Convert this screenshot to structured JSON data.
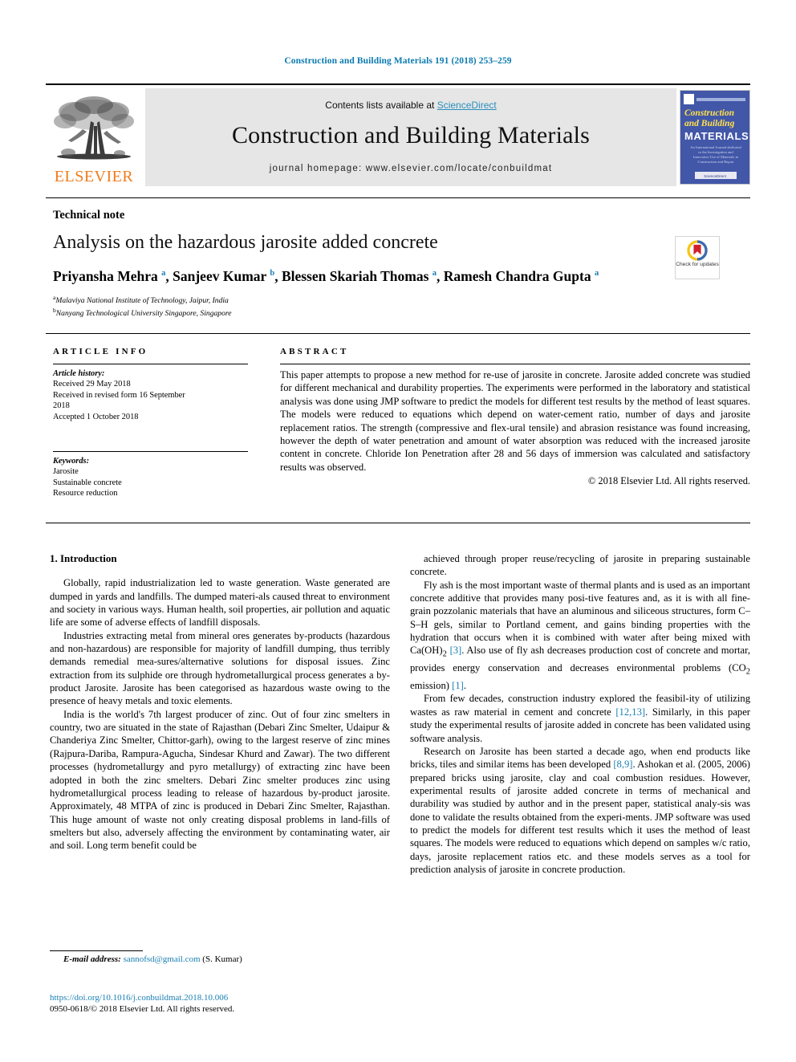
{
  "running_head": "Construction and Building Materials 191 (2018) 253–259",
  "masthead": {
    "contents_prefix": "Contents lists available at ",
    "sciencedirect": "ScienceDirect",
    "journal_title": "Construction and Building Materials",
    "homepage": "journal homepage: www.elsevier.com/locate/conbuildmat",
    "publisher_name": "ELSEVIER",
    "publisher_color": "#F07C1C",
    "band_color": "#e6e6e6",
    "cover": {
      "line1": "Construction",
      "line2": "and Building",
      "line3": "MATERIALS",
      "subtitle": "An International Journal dedicated to the Investigation and Innovative Use of Materials in Construction and Repair",
      "footer": "ScienceDirect",
      "bg_color": "#4257a8",
      "title_color": "#ffe14d"
    }
  },
  "article": {
    "doctype": "Technical note",
    "title": "Analysis on the hazardous jarosite added concrete",
    "authors_html": "Priyansha Mehra <sup>a</sup>, Sanjeev Kumar <sup>b</sup>, Blessen Skariah Thomas <sup>a</sup>, Ramesh Chandra Gupta <sup>a</sup>",
    "affiliations": [
      {
        "marker": "a",
        "text": "Malaviya National Institute of Technology, Jaipur, India"
      },
      {
        "marker": "b",
        "text": "Nanyang Technological University Singapore, Singapore"
      }
    ],
    "crossmark_label": "Check for updates"
  },
  "article_info": {
    "heading": "ARTICLE INFO",
    "history_heading": "Article history:",
    "history": [
      "Received 29 May 2018",
      "Received in revised form 16 September",
      "2018",
      "Accepted 1 October 2018"
    ],
    "keywords_heading": "Keywords:",
    "keywords": [
      "Jarosite",
      "Sustainable concrete",
      "Resource reduction"
    ]
  },
  "abstract": {
    "heading": "ABSTRACT",
    "text": "This paper attempts to propose a new method for re-use of jarosite in concrete. Jarosite added concrete was studied for different mechanical and durability properties. The experiments were performed in the laboratory and statistical analysis was done using JMP software to predict the models for different test results by the method of least squares. The models were reduced to equations which depend on water-cement ratio, number of days and jarosite replacement ratios. The strength (compressive and flex-ural tensile) and abrasion resistance was found increasing, however the depth of water penetration and amount of water absorption was reduced with the increased jarosite content in concrete. Chloride Ion Penetration after 28 and 56 days of immersion was calculated and satisfactory results was observed.",
    "copyright": "© 2018 Elsevier Ltd. All rights reserved."
  },
  "body": {
    "section_heading": "1. Introduction",
    "left_paragraphs": [
      "Globally, rapid industrialization led to waste generation. Waste generated are dumped in yards and landfills. The dumped materi-als caused threat to environment and society in various ways. Human health, soil properties, air pollution and aquatic life are some of adverse effects of landfill disposals.",
      "Industries extracting metal from mineral ores generates by-products (hazardous and non-hazardous) are responsible for majority of landfill dumping, thus terribly demands remedial mea-sures/alternative solutions for disposal issues. Zinc extraction from its sulphide ore through hydrometallurgical process generates a by-product Jarosite. Jarosite has been categorised as hazardous waste owing to the presence of heavy metals and toxic elements.",
      "India is the world's 7th largest producer of zinc. Out of four zinc smelters in country, two are situated in the state of Rajasthan (Debari Zinc Smelter, Udaipur & Chanderiya Zinc Smelter, Chittor-garh), owing to the largest reserve of zinc mines (Rajpura-Dariba, Rampura-Agucha, Sindesar Khurd and Zawar). The two different processes (hydrometallurgy and pyro metallurgy) of extracting zinc have been adopted in both the zinc smelters. Debari Zinc smelter produces zinc using hydrometallurgical process leading to release of hazardous by-product jarosite. Approximately, 48 MTPA of zinc is produced in Debari Zinc Smelter, Rajasthan. This huge amount of waste not only creating disposal problems in land-fills of smelters but also, adversely affecting the environment by contaminating water, air and soil. Long term benefit could be"
    ],
    "right_paragraphs_html": [
      "achieved through proper reuse/recycling of jarosite in preparing sustainable concrete.",
      "Fly ash is the most important waste of thermal plants and is used as an important concrete additive that provides many posi-tive features and, as it is with all fine-grain pozzolanic materials that have an aluminous and siliceous structures, form C–S–H gels, similar to Portland cement, and gains binding properties with the hydration that occurs when it is combined with water after being mixed with Ca(OH)<sub>2</sub> <span class=\"ref\">[3]</span>. Also use of fly ash decreases production cost of concrete and mortar, provides energy conservation and decreases environmental problems (CO<sub>2</sub> emission) <span class=\"ref\">[1]</span>.",
      "From few decades, construction industry explored the feasibil-ity of utilizing wastes as raw material in cement and concrete <span class=\"ref\">[12,13]</span>. Similarly, in this paper study the experimental results of jarosite added in concrete has been validated using software analysis.",
      "Research on Jarosite has been started a decade ago, when end products like bricks, tiles and similar items has been developed <span class=\"ref\">[8,9]</span>. Ashokan et al. (2005, 2006) prepared bricks using jarosite, clay and coal combustion residues. However, experimental results of jarosite added concrete in terms of mechanical and durability was studied by author and in the present paper, statistical analy-sis was done to validate the results obtained from the experi-ments. JMP software was used to predict the models for different test results which it uses the method of least squares. The models were reduced to equations which depend on samples w/c ratio, days, jarosite replacement ratios etc. and these models serves as a tool for prediction analysis of jarosite in concrete production."
    ]
  },
  "footer": {
    "email_label": "E-mail address:",
    "email": "sannofsd@gmail.com",
    "email_suffix": "(S. Kumar)",
    "doi": "https://doi.org/10.1016/j.conbuildmat.2018.10.006",
    "issn_line": "0950-0618/© 2018 Elsevier Ltd. All rights reserved."
  },
  "colors": {
    "link_blue": "#1a7fb3",
    "elsevier_orange": "#F07C1C"
  }
}
